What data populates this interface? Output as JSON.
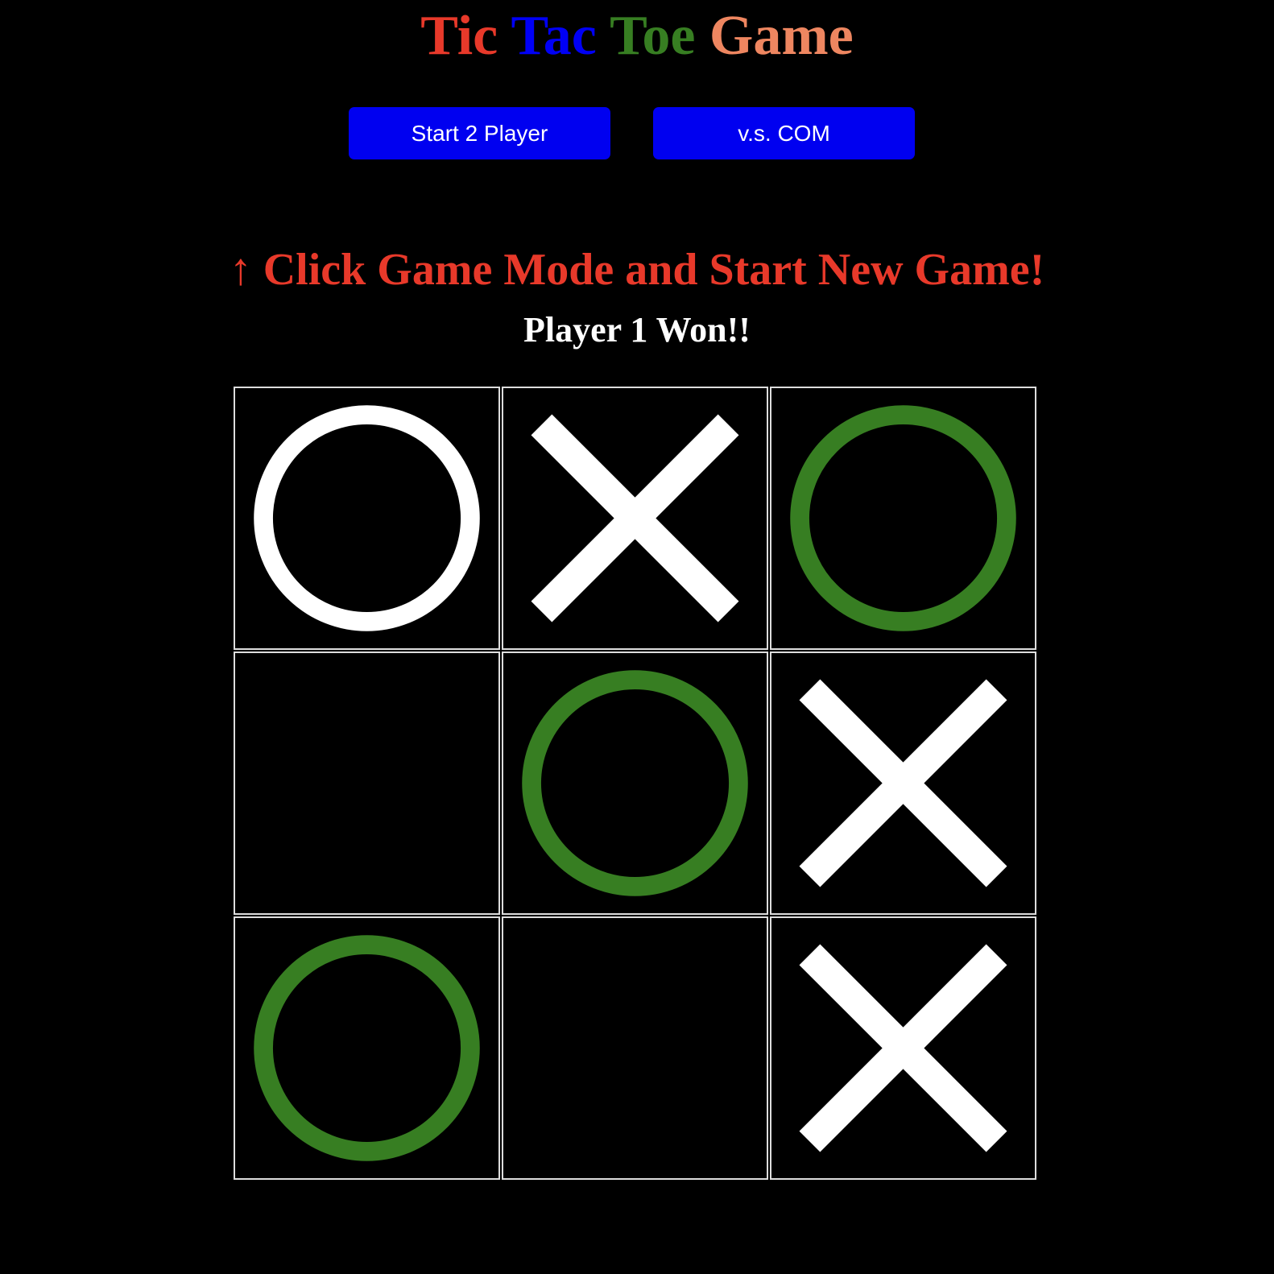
{
  "title": {
    "words": [
      {
        "text": "Tic",
        "color": "#E8392A"
      },
      {
        "text": "Tac",
        "color": "#0000F5"
      },
      {
        "text": "Toe",
        "color": "#377E22"
      },
      {
        "text": "Game",
        "color": "#EE8660"
      }
    ]
  },
  "buttons": {
    "two_player_label": "Start 2 Player",
    "vs_com_label": "v.s. COM",
    "color": "#0000F0"
  },
  "instruction": "↑ Click Game Mode and Start New Game!",
  "status": "Player 1 Won!!",
  "colors": {
    "mark": "#FFFFFF",
    "winning_mark": "#377E22",
    "grid_line": "#DDDDDD"
  },
  "board": {
    "cells": [
      {
        "mark": "O",
        "winning": false
      },
      {
        "mark": "X",
        "winning": false
      },
      {
        "mark": "O",
        "winning": true
      },
      {
        "mark": "",
        "winning": false
      },
      {
        "mark": "O",
        "winning": true
      },
      {
        "mark": "X",
        "winning": false
      },
      {
        "mark": "O",
        "winning": true
      },
      {
        "mark": "",
        "winning": false
      },
      {
        "mark": "X",
        "winning": false
      }
    ]
  }
}
